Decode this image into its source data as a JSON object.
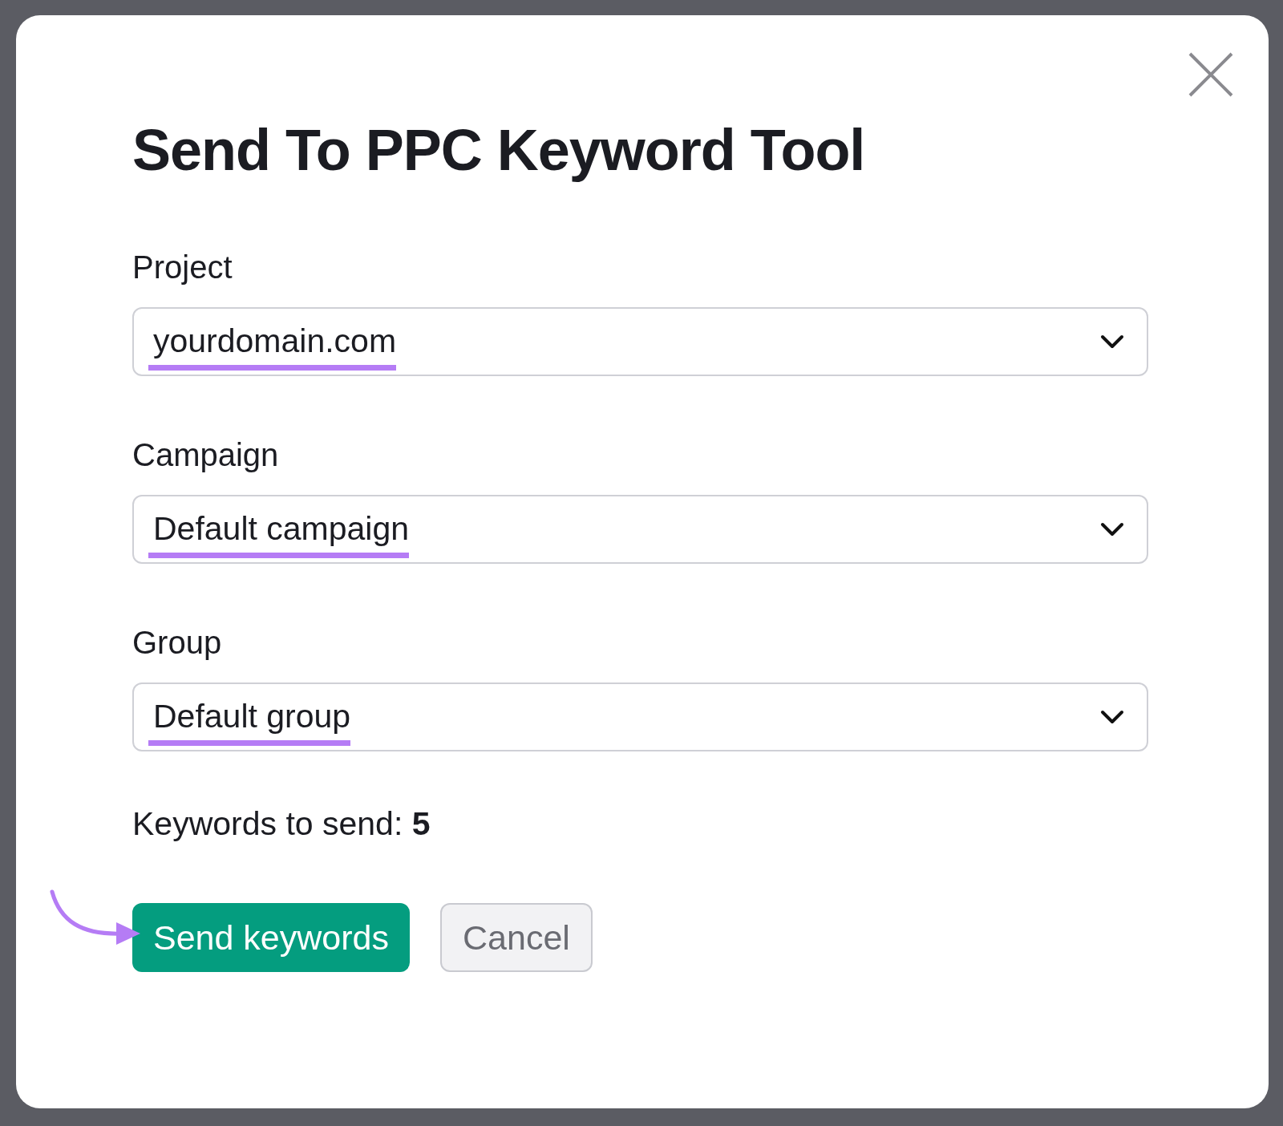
{
  "dialog": {
    "title": "Send To PPC Keyword Tool",
    "fields": [
      {
        "label": "Project",
        "value": "yourdomain.com"
      },
      {
        "label": "Campaign",
        "value": "Default campaign"
      },
      {
        "label": "Group",
        "value": "Default group"
      }
    ],
    "summary": "Keywords to send: **5**",
    "buttons": [
      {
        "label": "Send keywords",
        "kind": "primary"
      },
      {
        "label": "Cancel",
        "kind": "secondary"
      }
    ]
  }
}
